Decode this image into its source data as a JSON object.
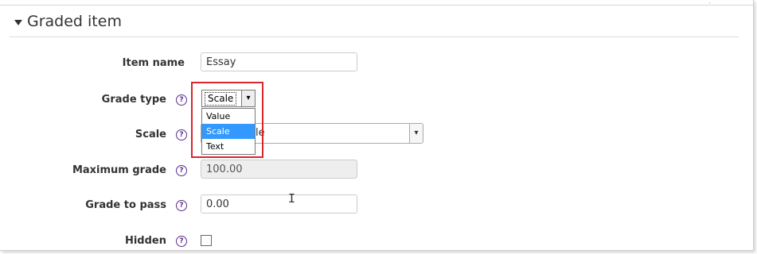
{
  "section": {
    "title": "Graded item"
  },
  "fields": {
    "item_name": {
      "label": "Item name",
      "value": "Essay"
    },
    "grade_type": {
      "label": "Grade type",
      "selected": "Scale",
      "options": [
        {
          "label": "Value",
          "selected": false
        },
        {
          "label": "Scale",
          "selected": true
        },
        {
          "label": "Text",
          "selected": false
        }
      ]
    },
    "scale": {
      "label": "Scale",
      "visible_value_fragment": "ale"
    },
    "maximum_grade": {
      "label": "Maximum grade",
      "value": "100.00"
    },
    "grade_to_pass": {
      "label": "Grade to pass",
      "value": "0.00"
    },
    "hidden": {
      "label": "Hidden",
      "checked": false
    }
  },
  "icons": {
    "help": "?",
    "arrow_down": "▾"
  },
  "colors": {
    "help_icon": "#5b2d8c",
    "highlight_box": "#d9262c",
    "option_selected": "#3399ff"
  }
}
